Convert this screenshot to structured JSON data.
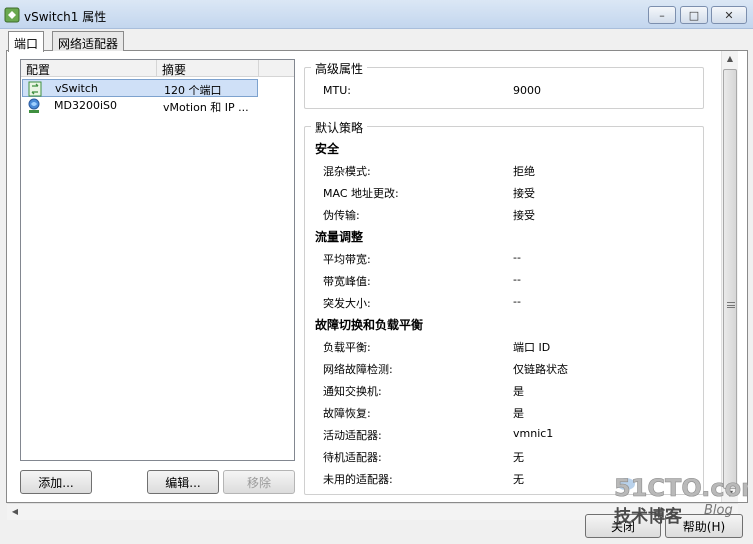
{
  "window": {
    "title": "vSwitch1 属性",
    "controls": {
      "minimize": "–",
      "maximize": "□",
      "close": "✕"
    }
  },
  "tabs": [
    {
      "label": "端口",
      "active": true
    },
    {
      "label": "网络适配器",
      "active": false
    }
  ],
  "ports_list": {
    "columns": [
      "配置",
      "摘要"
    ],
    "rows": [
      {
        "name": "vSwitch",
        "summary": "120 个端口",
        "icon": "vswitch-icon",
        "selected": true
      },
      {
        "name": "MD3200iS0",
        "summary": "vMotion 和 IP ...",
        "icon": "vmkernel-port-icon",
        "selected": false
      }
    ]
  },
  "buttons": {
    "add": "添加...",
    "edit": "编辑...",
    "remove": "移除",
    "close": "关闭",
    "help": "帮助(H)"
  },
  "advanced": {
    "title": "高级属性",
    "mtu_label": "MTU:",
    "mtu_value": "9000"
  },
  "policy": {
    "title": "默认策略",
    "security": {
      "heading": "安全",
      "items": [
        {
          "label": "混杂模式:",
          "value": "拒绝"
        },
        {
          "label": "MAC 地址更改:",
          "value": "接受"
        },
        {
          "label": "伪传输:",
          "value": "接受"
        }
      ]
    },
    "traffic": {
      "heading": "流量调整",
      "items": [
        {
          "label": "平均带宽:",
          "value": "--"
        },
        {
          "label": "带宽峰值:",
          "value": "--"
        },
        {
          "label": "突发大小:",
          "value": "--"
        }
      ]
    },
    "teaming": {
      "heading": "故障切换和负载平衡",
      "items": [
        {
          "label": "负载平衡:",
          "value": "端口 ID"
        },
        {
          "label": "网络故障检测:",
          "value": "仅链路状态"
        },
        {
          "label": "通知交换机:",
          "value": "是"
        },
        {
          "label": "故障恢复:",
          "value": "是"
        },
        {
          "label": "活动适配器:",
          "value": "vmnic1"
        },
        {
          "label": "待机适配器:",
          "value": "无"
        },
        {
          "label": "未用的适配器:",
          "value": "无"
        }
      ]
    }
  },
  "watermark": {
    "site": "51CTO.com",
    "caption": "技术博客",
    "tag": "Blog"
  },
  "colors": {
    "selection": "#cfe0f7",
    "title_bar": "#c3d6ee",
    "vswitch_green": "#3f8f3f"
  }
}
